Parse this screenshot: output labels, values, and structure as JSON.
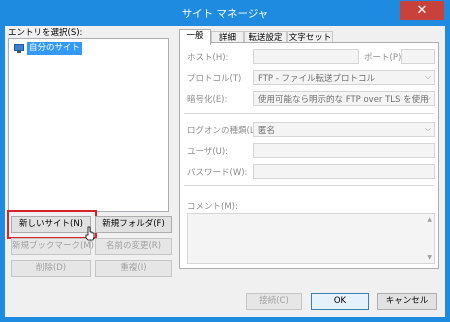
{
  "window": {
    "title": "サイト マネージャ",
    "close_glyph": "✕"
  },
  "left": {
    "entries_label": "エントリを選択(S):",
    "tree": [
      {
        "label": "自分のサイト",
        "icon": "site-monitor-icon"
      }
    ],
    "buttons": {
      "new_site": "新しいサイト(N)",
      "new_folder": "新規フォルダ(F)",
      "new_bookmark": "新規ブックマーク(M)",
      "rename": "名前の変更(R)",
      "delete": "削除(D)",
      "duplicate": "重複(I)"
    }
  },
  "tabs": [
    "一般",
    "詳細",
    "転送設定",
    "文字セット"
  ],
  "general": {
    "host_label": "ホスト(H):",
    "host_value": "",
    "port_label": "ポート(P):",
    "port_value": "",
    "protocol_label": "プロトコル(T)",
    "protocol_value": "FTP - ファイル転送プロトコル",
    "encryption_label": "暗号化(E):",
    "encryption_value": "使用可能なら明示的な FTP over TLS を使用",
    "logon_label": "ログオンの種類(L):",
    "logon_value": "匿名",
    "user_label": "ユーザ(U):",
    "user_value": "",
    "password_label": "パスワード(W):",
    "password_value": "",
    "comment_label": "コメント(M):",
    "comment_value": ""
  },
  "footer": {
    "connect": "接続(C)",
    "ok": "OK",
    "cancel": "キャンセル"
  }
}
